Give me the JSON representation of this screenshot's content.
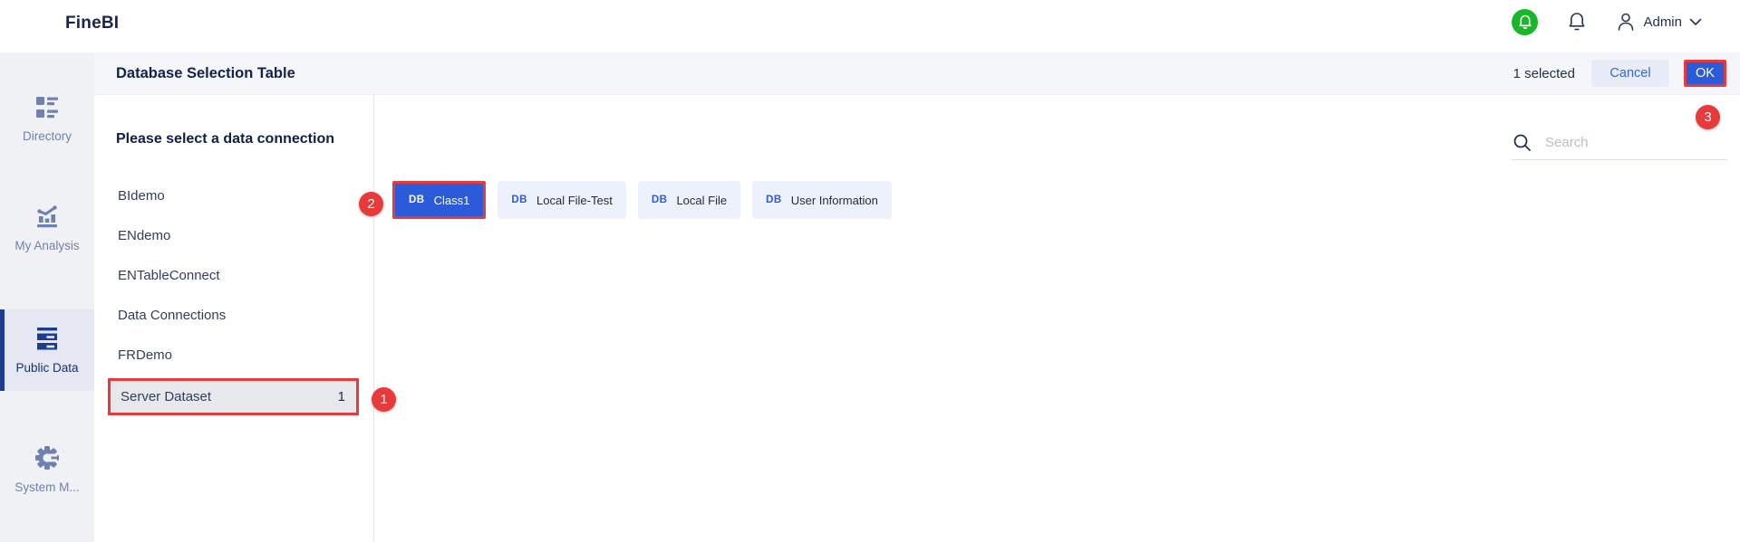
{
  "topbar": {
    "logo": "FineBI",
    "user_name": "Admin"
  },
  "sidebar": {
    "items": [
      {
        "label": "Directory",
        "icon": "directory-icon",
        "selected": false
      },
      {
        "label": "My Analysis",
        "icon": "analysis-icon",
        "selected": false
      },
      {
        "label": "Public Data",
        "icon": "public-data-icon",
        "selected": true
      },
      {
        "label": "System M...",
        "icon": "gear-icon",
        "selected": false
      }
    ]
  },
  "header": {
    "title": "Database Selection Table",
    "selected_count": "1 selected",
    "cancel_label": "Cancel",
    "ok_label": "OK"
  },
  "panel": {
    "heading": "Please select a data connection",
    "items": [
      {
        "label": "BIdemo"
      },
      {
        "label": "ENdemo"
      },
      {
        "label": "ENTableConnect"
      },
      {
        "label": "Data Connections"
      },
      {
        "label": "FRDemo"
      },
      {
        "label": "Server Dataset",
        "count": "1",
        "selected": true
      }
    ]
  },
  "main": {
    "search_placeholder": "Search",
    "db_icon_label": "DB",
    "chips": [
      {
        "label": "Class1",
        "selected": true
      },
      {
        "label": "Local File-Test",
        "selected": false
      },
      {
        "label": "Local File",
        "selected": false
      },
      {
        "label": "User Information",
        "selected": false
      }
    ]
  },
  "annotations": {
    "step1": "1",
    "step2": "2",
    "step3": "3"
  },
  "colors": {
    "primary_blue": "#2b5bd9",
    "annotation_red": "#e8393b",
    "notification_green": "#17b727",
    "sidebar_selected_bar": "#1e3c8f"
  }
}
